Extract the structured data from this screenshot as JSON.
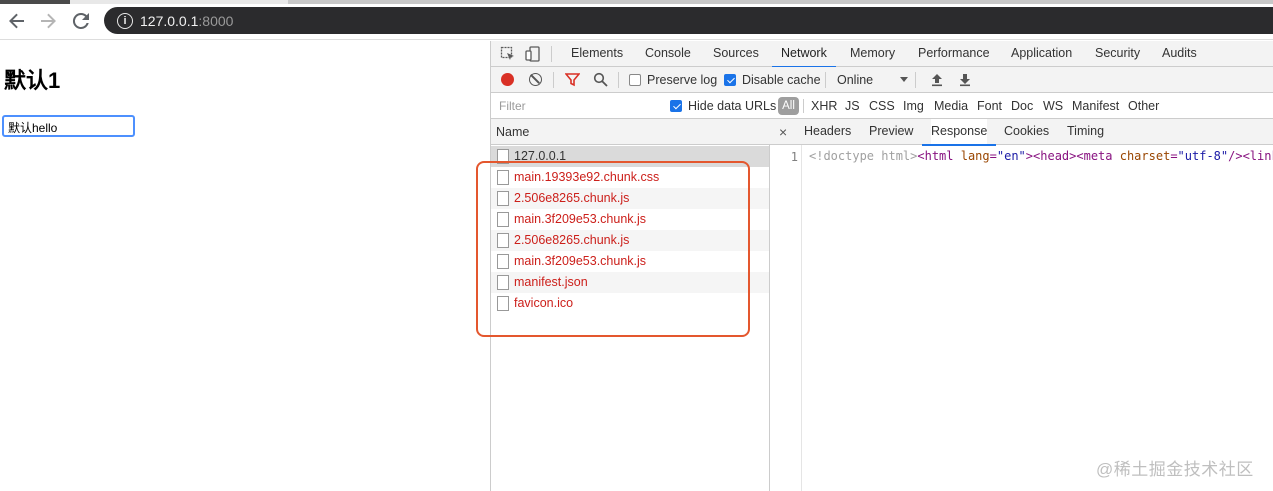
{
  "browser": {
    "url_host": "127.0.0.1",
    "url_port": ":8000",
    "back_icon": "arrow-left-icon",
    "forward_icon": "arrow-right-icon",
    "reload_icon": "reload-icon",
    "info_icon": "info-icon"
  },
  "page": {
    "heading": "默认1",
    "input_value": "默认hello"
  },
  "devtools": {
    "tabs": [
      {
        "label": "Elements"
      },
      {
        "label": "Console"
      },
      {
        "label": "Sources"
      },
      {
        "label": "Network",
        "active": true
      },
      {
        "label": "Memory"
      },
      {
        "label": "Performance"
      },
      {
        "label": "Application"
      },
      {
        "label": "Security"
      },
      {
        "label": "Audits"
      }
    ],
    "toolbar": {
      "preserve_log": "Preserve log",
      "preserve_log_checked": false,
      "disable_cache": "Disable cache",
      "disable_cache_checked": true,
      "throttle": "Online"
    },
    "filter": {
      "placeholder": "Filter",
      "hide_data_urls": "Hide data URLs",
      "hide_data_urls_checked": true,
      "all": "All",
      "types": [
        "XHR",
        "JS",
        "CSS",
        "Img",
        "Media",
        "Font",
        "Doc",
        "WS",
        "Manifest",
        "Other"
      ]
    },
    "requests": {
      "column_header": "Name",
      "rows": [
        {
          "name": "127.0.0.1",
          "selected": true
        },
        {
          "name": "main.19393e92.chunk.css"
        },
        {
          "name": "2.506e8265.chunk.js"
        },
        {
          "name": "main.3f209e53.chunk.js"
        },
        {
          "name": "2.506e8265.chunk.js"
        },
        {
          "name": "main.3f209e53.chunk.js"
        },
        {
          "name": "manifest.json"
        },
        {
          "name": "favicon.ico"
        }
      ]
    },
    "detail": {
      "close": "×",
      "tabs": [
        {
          "label": "Headers"
        },
        {
          "label": "Preview"
        },
        {
          "label": "Response",
          "active": true
        },
        {
          "label": "Cookies"
        },
        {
          "label": "Timing"
        }
      ],
      "line_number": "1",
      "code": {
        "doctype": "<!doctype html>",
        "html_open": "<html ",
        "lang_attr": "lang",
        "eq1": "=",
        "lang_val": "\"en\"",
        "html_close": ">",
        "head": "<head>",
        "meta_open": "<meta ",
        "charset_attr": "charset",
        "eq2": "=",
        "charset_val": "\"utf-8\"",
        "meta_close": "/>",
        "link": "<link"
      }
    }
  },
  "annotation": {
    "color": "#e4572e"
  },
  "watermark": "@稀土掘金技术社区"
}
